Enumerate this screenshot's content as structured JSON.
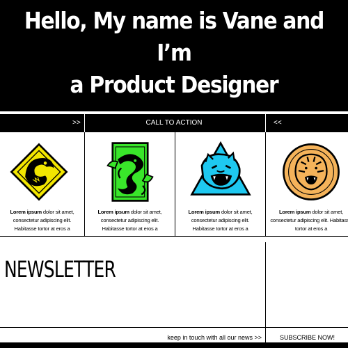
{
  "hero": {
    "title_line1": "Hello, My name is Vane and  I’m",
    "title_line2": "a Product Designer"
  },
  "nav_bar": {
    "next_label": ">>",
    "cta_label": "CALL TO ACTION",
    "prev_label": "<<"
  },
  "gallery": {
    "cards": [
      {
        "icon": "snake-badge-icon",
        "caption_bold": "Lorem ipsum",
        "caption_text": " dolor sit amet, consectetur adipiscing elit. Habitasse tortor at eros a",
        "color": "#f2e600"
      },
      {
        "icon": "dragon-badge-icon",
        "caption_bold": "Lorem ipsum",
        "caption_text": " dolor sit amet, consectetur adipiscing elit. Habitasse tortor at eros a",
        "color": "#39e62a"
      },
      {
        "icon": "panther-badge-icon",
        "caption_bold": "Lorem ipsum",
        "caption_text": " dolor sit amet, consectetur adipiscing elit. Habitasse tortor at eros a",
        "color": "#1ec8f0"
      },
      {
        "icon": "tiger-badge-icon",
        "caption_bold": "Lorem ipsum",
        "caption_text": " dolor sit amet, consectetur adipiscing elit. Habitasse tortor at eros a",
        "color": "#f5b35a"
      }
    ]
  },
  "newsletter": {
    "title": "NEWSLETTER",
    "keep_in_touch": "keep in touch with all our news >>",
    "subscribe_label": "SUBSCRIBE NOW!"
  }
}
